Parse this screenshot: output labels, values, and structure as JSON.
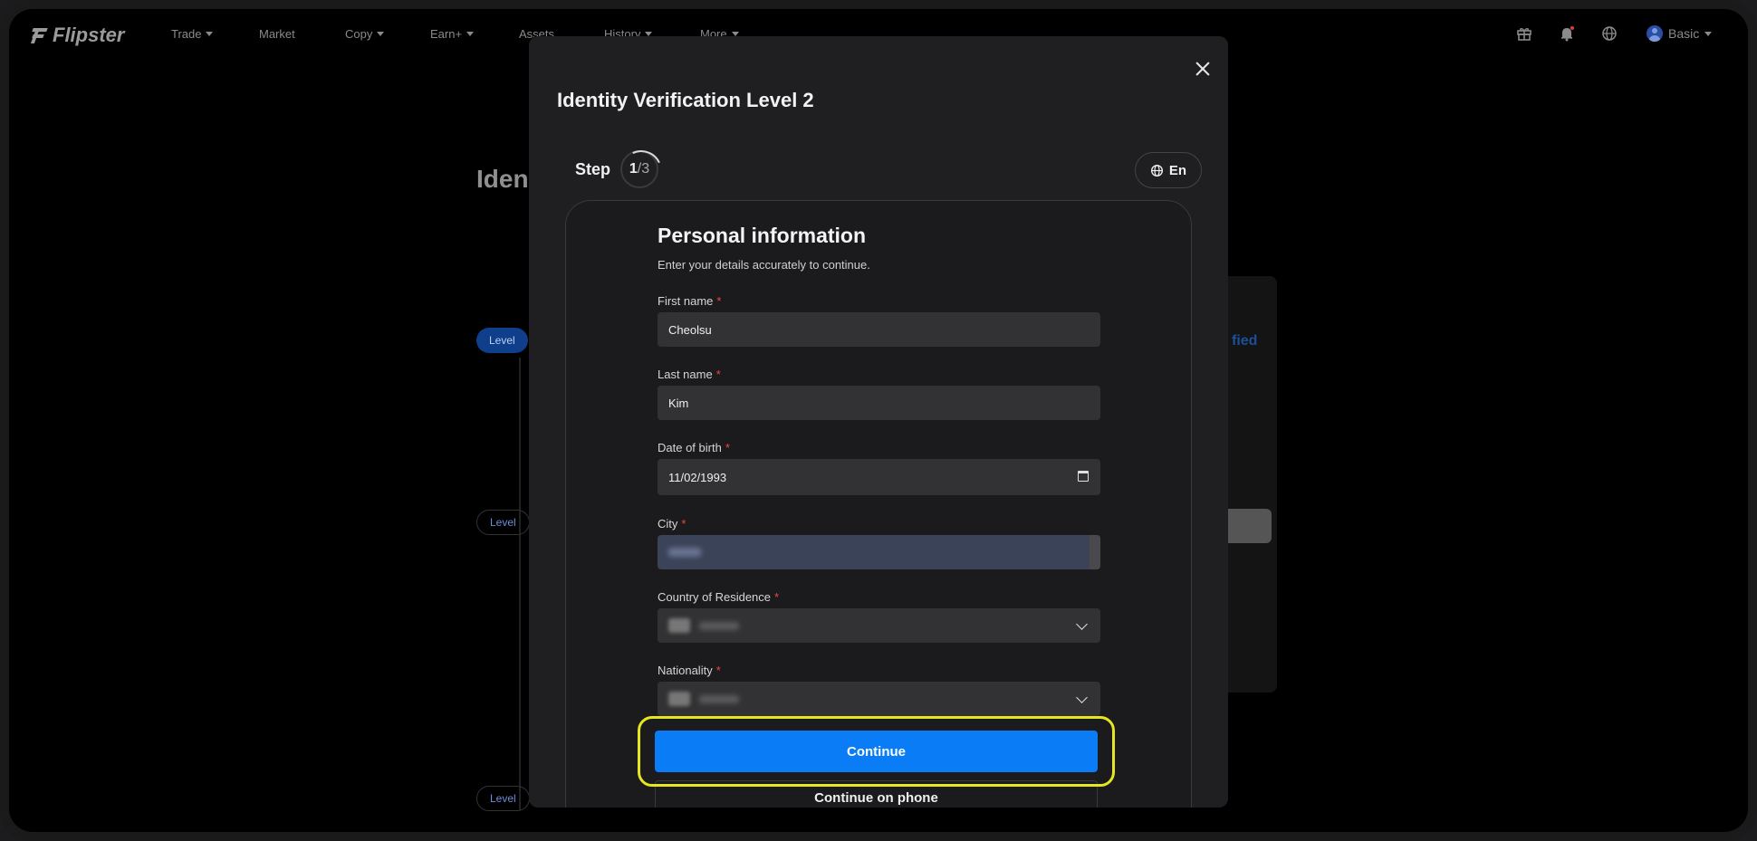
{
  "nav": {
    "logo": "Flipster",
    "items": [
      {
        "label": "Trade",
        "has_caret": true
      },
      {
        "label": "Market",
        "has_caret": false
      },
      {
        "label": "Copy",
        "has_caret": true
      },
      {
        "label": "Earn+",
        "has_caret": true
      },
      {
        "label": "Assets",
        "has_caret": false
      },
      {
        "label": "History",
        "has_caret": true
      },
      {
        "label": "More",
        "has_caret": true
      }
    ],
    "account_label": "Basic"
  },
  "background": {
    "title": "Iden",
    "pill_1": "Level",
    "pill_2": "Level",
    "pill_3": "Level",
    "verified_text": "fied"
  },
  "modal": {
    "title": "Identity Verification Level 2",
    "step_label": "Step",
    "step_current": "1",
    "step_total": "/3",
    "language": "En",
    "form": {
      "title": "Personal information",
      "subtitle": "Enter your details accurately to continue.",
      "required_mark": "*",
      "fields": {
        "first_name": {
          "label": "First name",
          "value": "Cheolsu"
        },
        "last_name": {
          "label": "Last name",
          "value": "Kim"
        },
        "dob": {
          "label": "Date of birth",
          "value": "11/02/1993"
        },
        "city": {
          "label": "City"
        },
        "country": {
          "label": "Country of Residence"
        },
        "nationality": {
          "label": "Nationality"
        }
      },
      "continue_label": "Continue",
      "phone_label": "Continue on phone"
    }
  },
  "colors": {
    "accent": "#0a7cf5",
    "highlight": "#e6e620",
    "required": "#f04545"
  }
}
